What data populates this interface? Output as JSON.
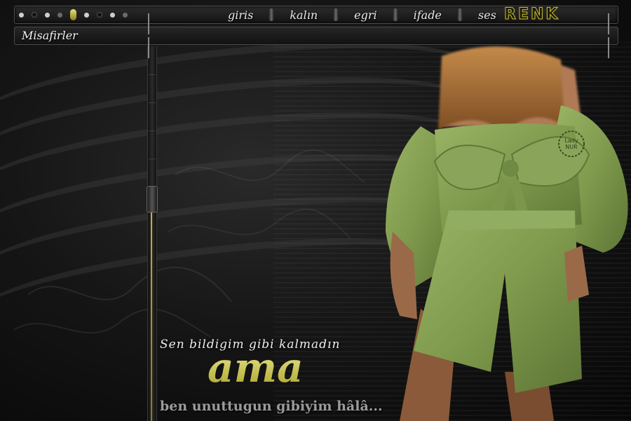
{
  "toolbar": {
    "menu": [
      "giris",
      "kalın",
      "egri",
      "ifade",
      "ses"
    ],
    "renk_label": "RENK"
  },
  "visitors": {
    "label": "Misafirler"
  },
  "poem": {
    "line1": "Sen bildigim gibi kalmadın",
    "line2": "ama",
    "line3": "ben unuttugun gibiyim hâlâ..."
  },
  "watermark": {
    "text": "Lady NUR"
  },
  "colors": {
    "accent_gold": "#cbc23a",
    "dress_green": "#7f9a4c",
    "background": "#0b0b0b"
  }
}
